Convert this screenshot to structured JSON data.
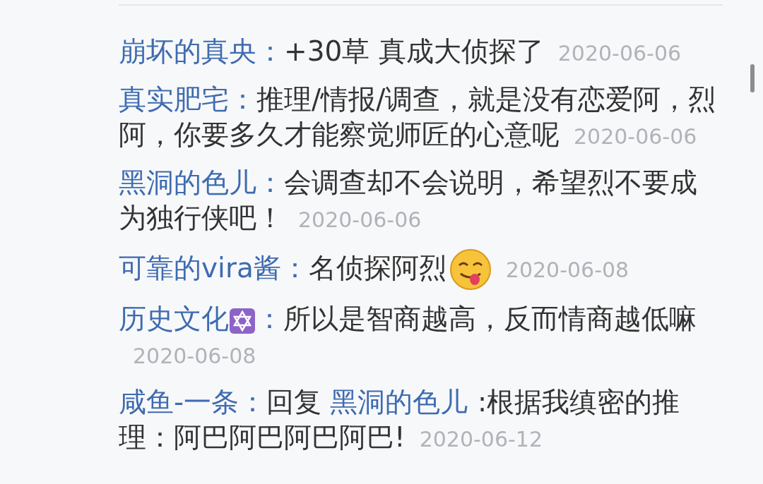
{
  "comments": [
    {
      "author": "崩坏的真央：",
      "author_badge": false,
      "text": "+30草 真成大侦探了",
      "emoji": false,
      "date": "2020-06-06"
    },
    {
      "author": "真实肥宅：",
      "author_badge": false,
      "text": "推理/情报/调查，就是没有恋爱阿，烈阿，你要多久才能察觉师匠的心意呢",
      "emoji": false,
      "date": "2020-06-06"
    },
    {
      "author": "黑洞的色儿：",
      "author_badge": false,
      "text": "会调查却不会说明，希望烈不要成为独行侠吧！",
      "emoji": false,
      "date": "2020-06-06"
    },
    {
      "author": "可靠的vira酱：",
      "author_badge": false,
      "text": "名侦探阿烈",
      "emoji": true,
      "date": "2020-06-08"
    },
    {
      "author": "历史文化",
      "author_badge": true,
      "author_colon": "：",
      "text": "所以是智商越高，反而情商越低嘛",
      "emoji": false,
      "date": "2020-06-08"
    },
    {
      "author": "咸鱼-一条：",
      "author_badge": false,
      "reply_label": "回复",
      "reply_to": "黑洞的色儿",
      "text": ":根据我缜密的推理：阿巴阿巴阿巴阿巴!",
      "emoji": false,
      "date": "2020-06-12"
    }
  ]
}
